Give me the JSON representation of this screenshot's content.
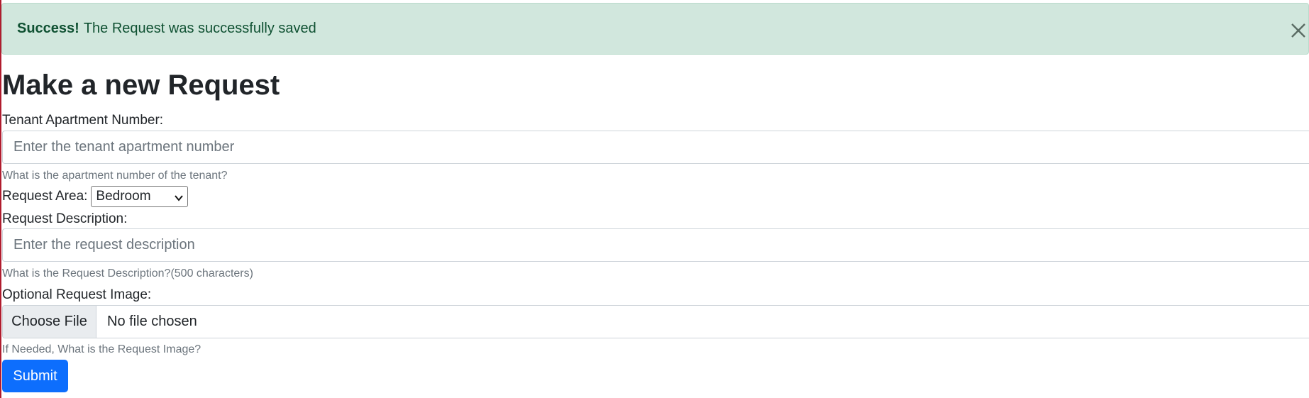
{
  "alert": {
    "strong": "Success!",
    "message": "The Request was successfully saved"
  },
  "page_title": "Make a new Request",
  "apartment": {
    "label": "Tenant Apartment Number:",
    "placeholder": "Enter the tenant apartment number",
    "help": "What is the apartment number of the tenant?"
  },
  "area": {
    "label": "Request Area:",
    "selected": "Bedroom"
  },
  "description": {
    "label": "Request Description:",
    "placeholder": "Enter the request description",
    "help": "What is the Request Description?(500 characters)"
  },
  "image": {
    "label": "Optional Request Image:",
    "button": "Choose File",
    "status": "No file chosen",
    "help": "If Needed, What is the Request Image?"
  },
  "submit_label": "Submit",
  "icons": {
    "close": "close-icon",
    "dropdown": "chevron-down-icon"
  },
  "colors": {
    "alert_bg": "#d1e7dd",
    "alert_text": "#0f5132",
    "primary": "#0d6efd",
    "muted": "#6c757d"
  }
}
